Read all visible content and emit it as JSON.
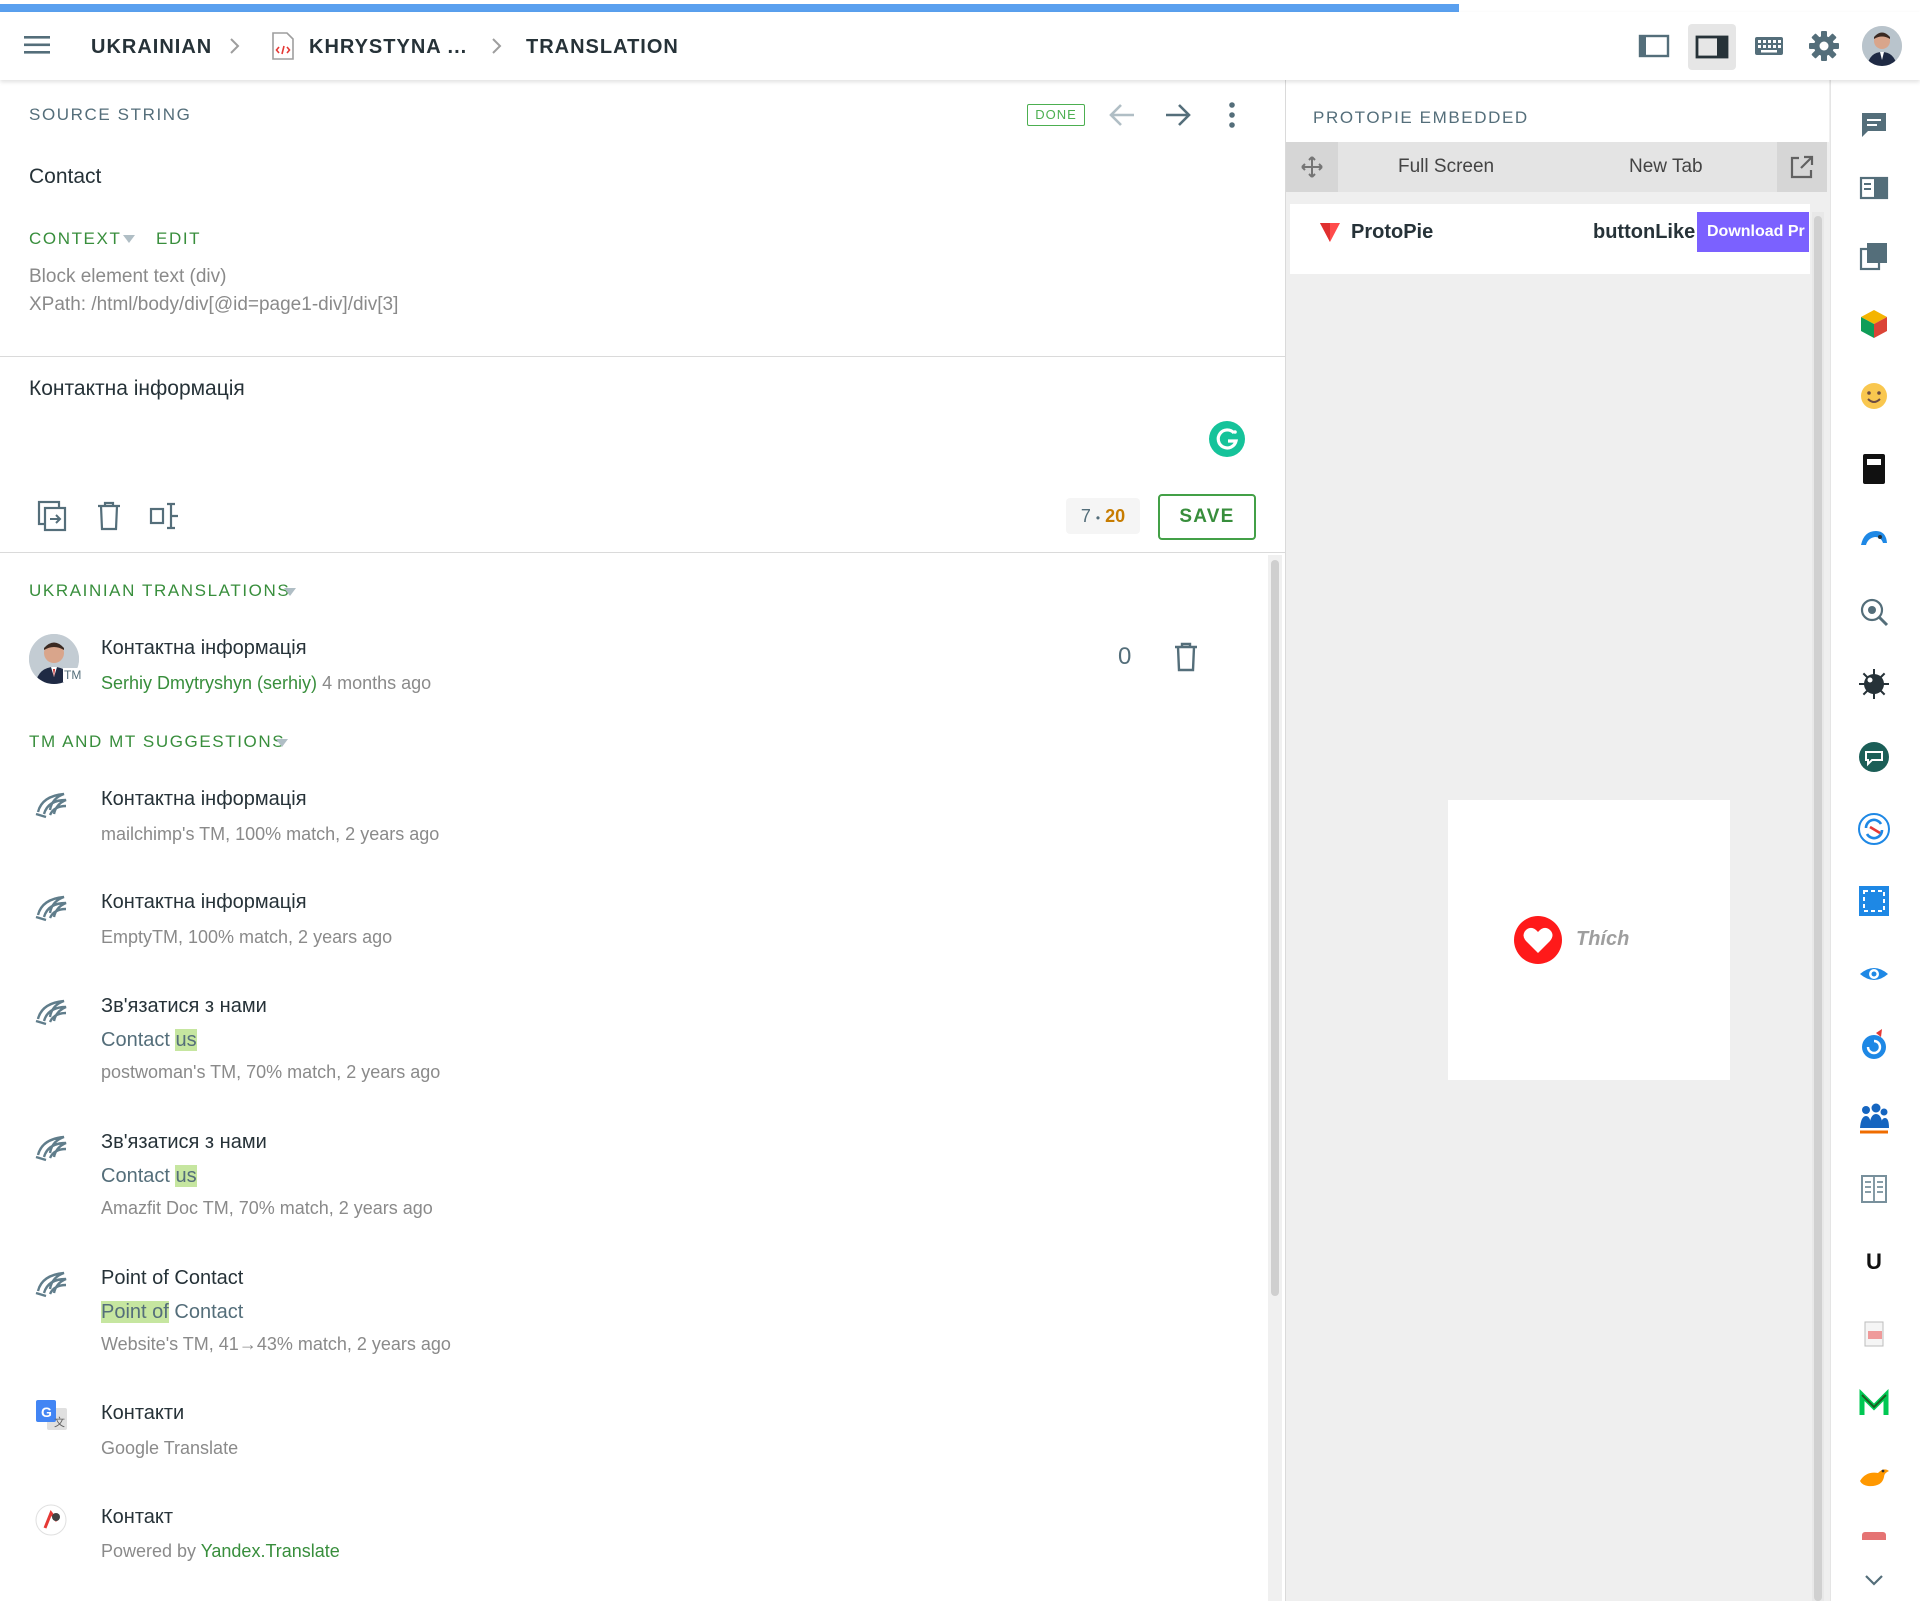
{
  "topbar": {
    "progress_fraction": 0.76,
    "crumb_language": "UKRAINIAN",
    "crumb_file": "KHRYSTYNA ...",
    "crumb_section": "TRANSLATION",
    "icons": [
      "menu-icon",
      "file-code-icon",
      "layout-left-icon",
      "layout-right-icon",
      "keyboard-icon",
      "gear-icon"
    ]
  },
  "source": {
    "label": "SOURCE STRING",
    "done_badge": "DONE",
    "text": "Contact",
    "context_label": "CONTEXT",
    "edit_label": "EDIT",
    "context_line1": "Block element text (div)",
    "context_line2": "XPath: /html/body/div[@id=page1-div]/div[3]"
  },
  "editor": {
    "value": "Контактна інформація",
    "count_current": "7",
    "count_dot": "•",
    "count_max": "20",
    "save_label": "SAVE"
  },
  "translations": {
    "heading": "UKRAINIAN TRANSLATIONS",
    "items": [
      {
        "text": "Контактна інформація",
        "author": "Serhiy Dmytryshyn (serhiy)",
        "time": "4 months ago",
        "votes": "0"
      }
    ]
  },
  "suggestions": {
    "heading": "TM AND MT SUGGESTIONS",
    "items": [
      {
        "text": "Контактна інформація",
        "source": "mailchimp's TM, 100% match, 2 years ago"
      },
      {
        "text": "Контактна інформація",
        "source": "EmptyTM, 100% match, 2 years ago"
      },
      {
        "text": "Зв'язатися з нами",
        "orig_plain": "Contact ",
        "orig_hl": "us",
        "source": "postwoman's TM, 70% match, 2 years ago"
      },
      {
        "text": "Зв'язатися з нами",
        "orig_plain": "Contact ",
        "orig_hl": "us",
        "source": "Amazfit Doc TM, 70% match, 2 years ago"
      },
      {
        "text": "Point of Contact",
        "orig_hl": "Point of",
        "orig_plain": " Contact",
        "source": "Website's TM, 41→43% match, 2 years ago"
      },
      {
        "text": "Контакти",
        "source": "Google Translate"
      },
      {
        "text": "Контакт",
        "source_prefix": "Powered by ",
        "source_link": "Yandex.Translate"
      }
    ]
  },
  "right_panel": {
    "title": "PROTOPIE EMBEDDED",
    "full_screen": "Full Screen",
    "new_tab": "New Tab",
    "brand": "ProtoPie",
    "file_name": "buttonLike",
    "download": "Download Pr",
    "like_label": "Thích",
    "accent": "#7b61ff"
  },
  "extensions": {
    "icons": [
      "comment-icon",
      "reader-icon",
      "copy-icon",
      "cube-icon",
      "smile-icon",
      "book-icon",
      "bird-icon",
      "search-icon",
      "mine-icon",
      "chat-icon",
      "sync-icon",
      "screenshot-icon",
      "eye-icon",
      "translate-icon",
      "people-icon",
      "columns-icon",
      "u-icon",
      "pdf-icon",
      "m-icon",
      "duck-icon",
      "card-icon",
      "chevron-down-icon"
    ],
    "u_letter": "U"
  }
}
